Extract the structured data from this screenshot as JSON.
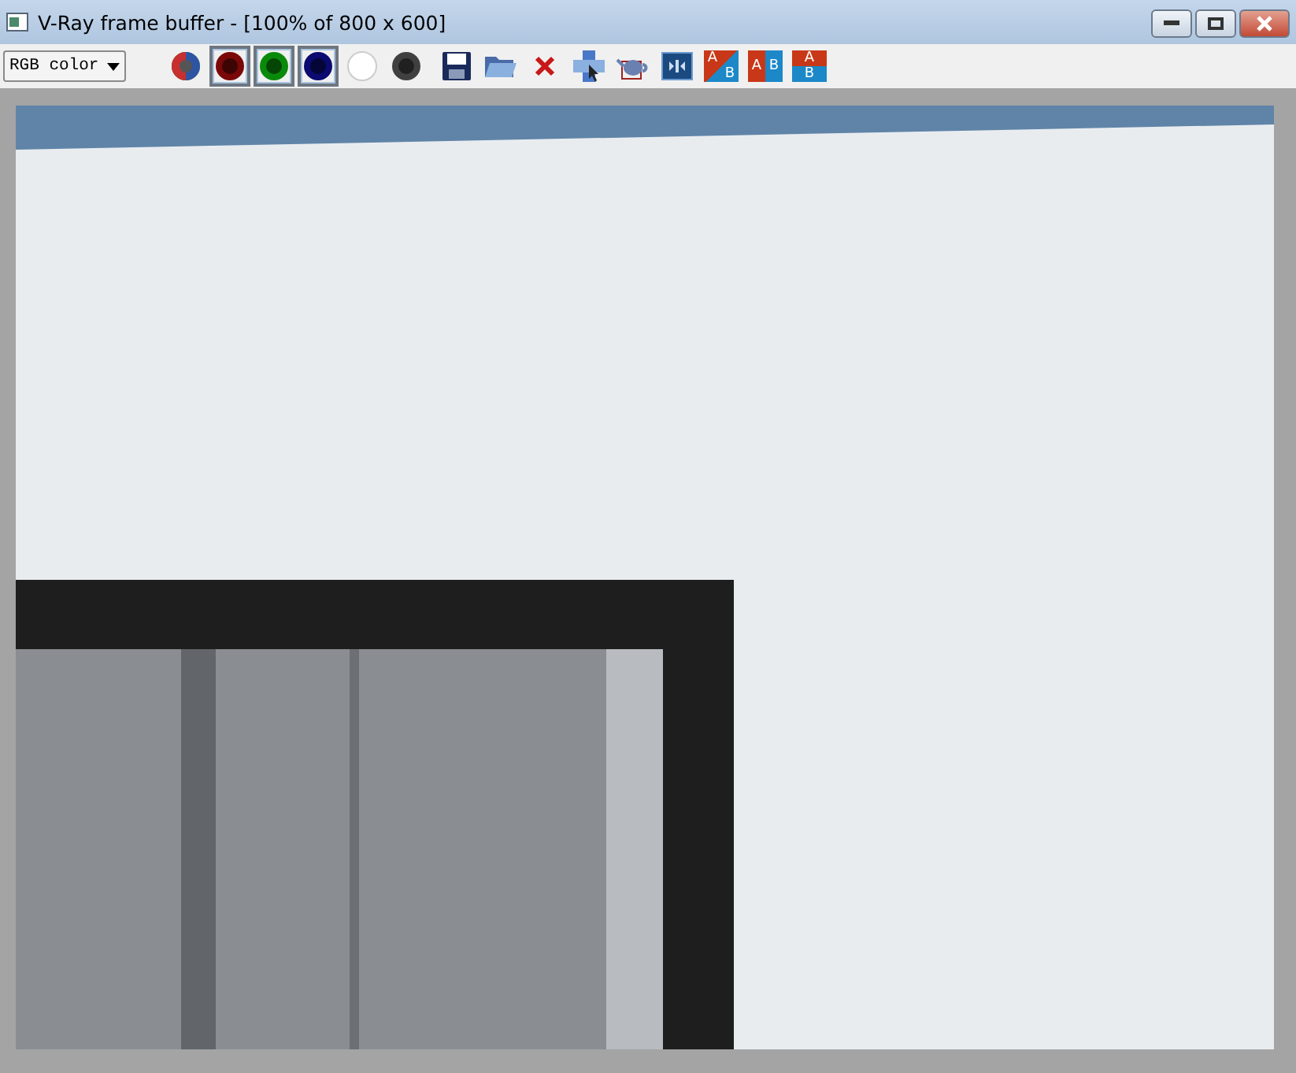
{
  "window": {
    "title": "V-Ray frame buffer - [100% of 800 x 600]"
  },
  "toolbar": {
    "channel_select": {
      "value": "RGB color"
    },
    "channel_buttons": [
      {
        "kind": "rgb",
        "selected": false
      },
      {
        "kind": "red",
        "selected": true
      },
      {
        "kind": "green",
        "selected": true
      },
      {
        "kind": "blue",
        "selected": true
      },
      {
        "kind": "mono",
        "selected": false
      },
      {
        "kind": "alpha",
        "selected": false
      }
    ],
    "tools": [
      {
        "kind": "save"
      },
      {
        "kind": "open"
      },
      {
        "kind": "clear"
      },
      {
        "kind": "track"
      },
      {
        "kind": "render"
      },
      {
        "kind": "split"
      }
    ],
    "compare_buttons": [
      {
        "kind": "diagonal",
        "a": "A",
        "b": "B"
      },
      {
        "kind": "horizontal",
        "a": "A",
        "b": "B"
      },
      {
        "kind": "vertical",
        "a": "A",
        "b": "B"
      }
    ]
  }
}
